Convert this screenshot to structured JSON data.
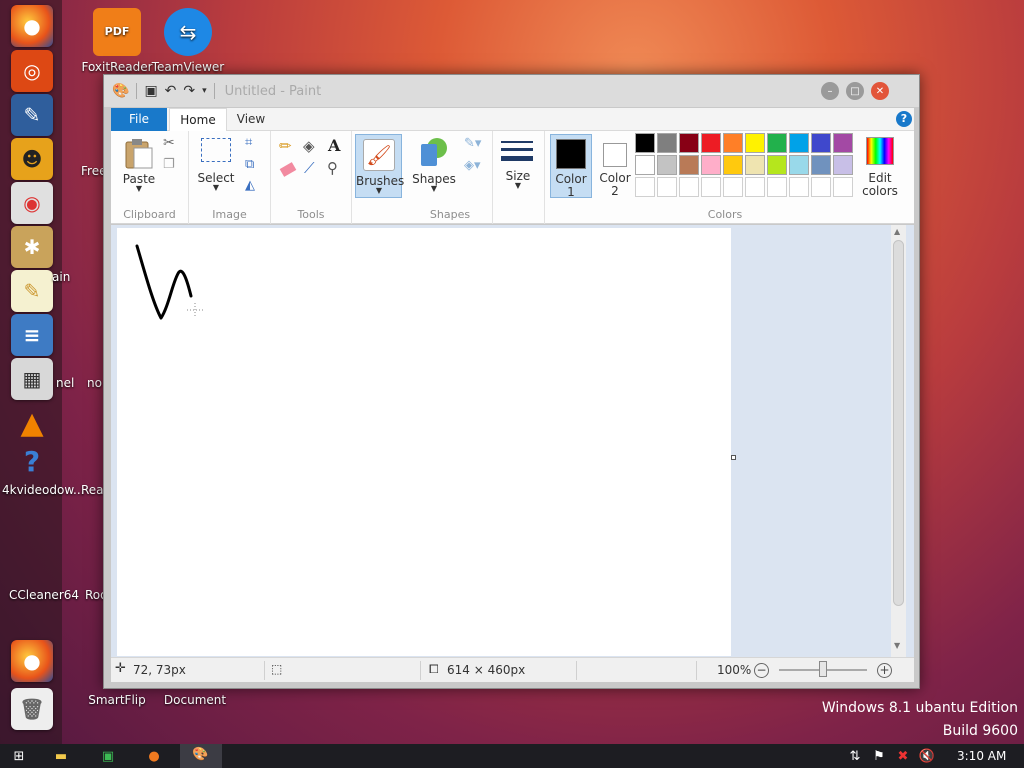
{
  "desktop": {
    "icons": [
      {
        "label": "FoxitReader"
      },
      {
        "label": "TeamViewer"
      },
      {
        "label": "SmartFlip"
      },
      {
        "label": "Document"
      }
    ],
    "partial_labels": [
      "Free",
      "ain",
      "nel",
      "no",
      "4kvideodow...",
      "Rea",
      "CCleaner64",
      "Roo"
    ],
    "watermark_line1": "Windows 8.1 ubantu Edition",
    "watermark_line2": "Build 9600"
  },
  "window": {
    "title": "Untitled - Paint",
    "tabs": {
      "file": "File",
      "home": "Home",
      "view": "View"
    },
    "ribbon": {
      "clipboard": {
        "paste": "Paste",
        "label": "Clipboard"
      },
      "image": {
        "select": "Select",
        "label": "Image"
      },
      "tools": {
        "label": "Tools",
        "text_tool": "A"
      },
      "brushes": {
        "label": "Brushes"
      },
      "shapes": {
        "button": "Shapes",
        "label": "Shapes"
      },
      "size": {
        "label": "Size"
      },
      "colors": {
        "color1_line1": "Color",
        "color1_line2": "1",
        "color2_line1": "Color",
        "color2_line2": "2",
        "edit_line1": "Edit",
        "edit_line2": "colors",
        "label": "Colors",
        "color1_value": "#000000",
        "color2_value": "#ffffff",
        "row1": [
          "#000000",
          "#7f7f7f",
          "#880015",
          "#ed1c24",
          "#ff7f27",
          "#fff200",
          "#22b14c",
          "#00a2e8",
          "#3f48cc",
          "#a349a4"
        ],
        "row2": [
          "#ffffff",
          "#c3c3c3",
          "#b97a57",
          "#ffaec9",
          "#ffc90e",
          "#efe4b0",
          "#b5e61d",
          "#99d9ea",
          "#7092be",
          "#c8bfe7"
        ],
        "row3": [
          "#ffffff",
          "#ffffff",
          "#ffffff",
          "#ffffff",
          "#ffffff",
          "#ffffff",
          "#ffffff",
          "#ffffff",
          "#ffffff",
          "#ffffff"
        ]
      }
    },
    "status": {
      "cursor": "72, 73px",
      "canvas_size": "614 × 460px",
      "zoom": "100%"
    }
  },
  "taskbar": {
    "time": "3:10 AM"
  }
}
